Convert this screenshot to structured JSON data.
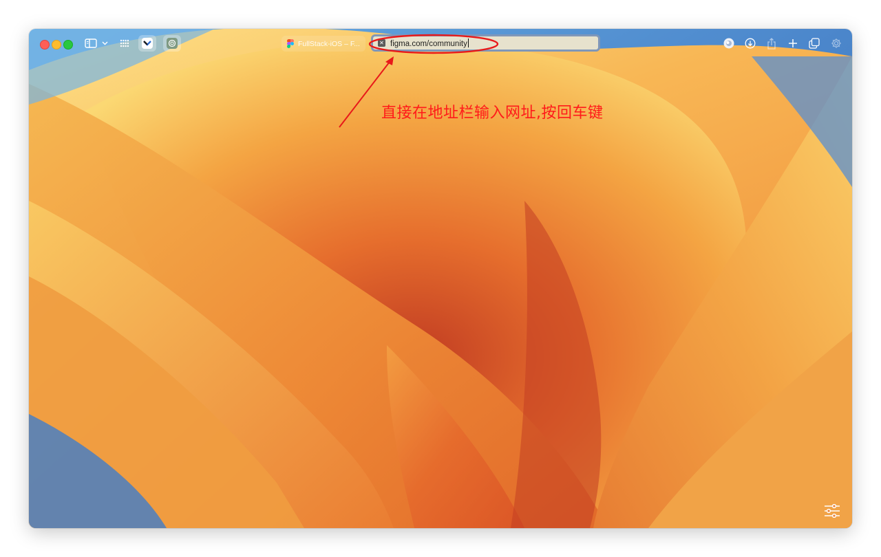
{
  "window": {
    "traffic_lights": {
      "close": "close-button",
      "minimize": "minimize-button",
      "zoom": "zoom-button"
    }
  },
  "toolbar": {
    "sidebar_icon": "sidebar-icon",
    "tab_overview_icon": "grid-icon",
    "extension_1_icon": "bookmark-extension-icon",
    "extension_2_icon": "openai-extension-icon",
    "right_icons": [
      "profile-icon",
      "download-icon",
      "share-icon",
      "plus-icon",
      "tabs-overview-icon",
      "gear-icon"
    ]
  },
  "tab": {
    "title": "FullStack-iOS – F..."
  },
  "address_bar": {
    "value": "figma.com/community"
  },
  "annotation": {
    "text": "直接在地址栏输入网址,按回车键",
    "color": "#ff1a1a"
  },
  "colors": {
    "wallpaper_orange": "#f0923a",
    "wallpaper_blue": "#4a86c8",
    "address_bar_border": "#7f97b9"
  }
}
